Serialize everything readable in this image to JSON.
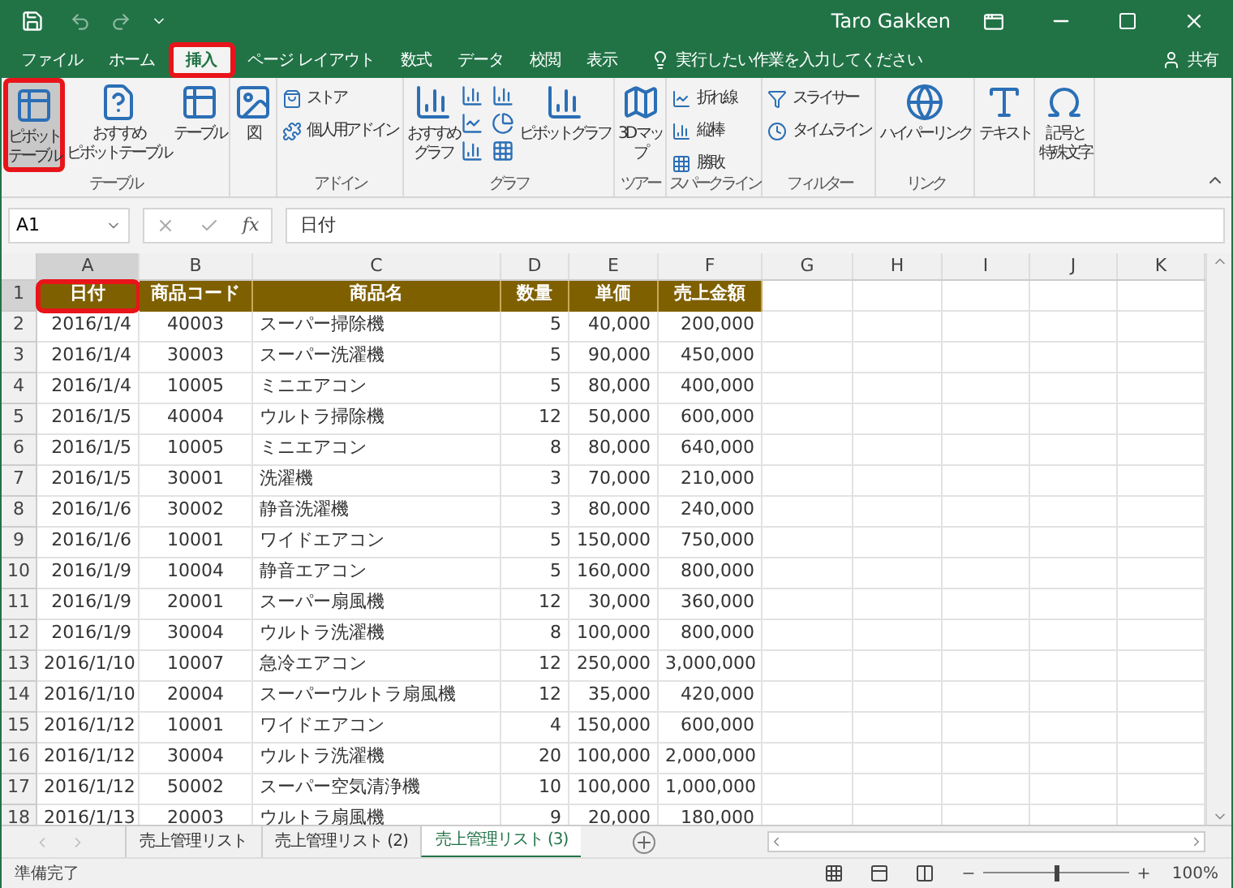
{
  "title_bar": {
    "user": "Taro Gakken"
  },
  "ribbon_tabs": [
    {
      "label": "ファイル",
      "selected": false,
      "highlighted": false
    },
    {
      "label": "ホーム",
      "selected": false,
      "highlighted": false
    },
    {
      "label": "挿入",
      "selected": true,
      "highlighted": true
    },
    {
      "label": "ページ レイアウト",
      "selected": false,
      "highlighted": false
    },
    {
      "label": "数式",
      "selected": false,
      "highlighted": false
    },
    {
      "label": "データ",
      "selected": false,
      "highlighted": false
    },
    {
      "label": "校閲",
      "selected": false,
      "highlighted": false
    },
    {
      "label": "表示",
      "selected": false,
      "highlighted": false
    }
  ],
  "tell_me": {
    "placeholder": "実行したい作業を入力してください"
  },
  "share": "共有",
  "ribbon_groups": [
    {
      "label": "テーブル",
      "items": [
        {
          "kind": "large",
          "lines": [
            "ピボット",
            "テーブル"
          ],
          "highlighted": true
        },
        {
          "kind": "large",
          "lines": [
            "おすすめ",
            "ピボットテーブル"
          ],
          "highlighted": false
        },
        {
          "kind": "large",
          "lines": [
            "テーブル"
          ],
          "highlighted": false
        }
      ]
    },
    {
      "items": [
        {
          "kind": "large",
          "lines": [
            "図"
          ],
          "highlighted": false
        }
      ]
    },
    {
      "label": "アドイン",
      "items": [
        {
          "kind": "small",
          "label": "ストア",
          "highlighted": false
        },
        {
          "kind": "small",
          "label": "個人用アドイン",
          "highlighted": false
        }
      ]
    },
    {
      "label": "グラフ",
      "items": [
        {
          "kind": "large",
          "lines": [
            "おすすめ",
            "グラフ"
          ],
          "highlighted": false
        },
        {
          "kind": "charts"
        },
        {
          "kind": "large",
          "lines": [
            "ピボットグラフ"
          ],
          "highlighted": false
        }
      ]
    },
    {
      "label": "ツアー",
      "items": [
        {
          "kind": "large",
          "lines": [
            "3D マッ",
            "プ"
          ],
          "highlighted": false
        }
      ]
    },
    {
      "label": "スパークライン",
      "items": [
        {
          "kind": "small",
          "label": "折れ線",
          "highlighted": false
        },
        {
          "kind": "small",
          "label": "縦棒",
          "highlighted": false
        },
        {
          "kind": "small",
          "label": "勝敗",
          "highlighted": false
        }
      ]
    },
    {
      "label": "フィルター",
      "items": [
        {
          "kind": "small",
          "label": "スライサー",
          "highlighted": false
        },
        {
          "kind": "small",
          "label": "タイムライン",
          "highlighted": false
        }
      ]
    },
    {
      "label": "リンク",
      "items": [
        {
          "kind": "large",
          "lines": [
            "ハイパーリンク"
          ],
          "highlighted": false
        }
      ]
    },
    {
      "items": [
        {
          "kind": "large",
          "lines": [
            "テキスト"
          ],
          "highlighted": false
        }
      ]
    },
    {
      "items": [
        {
          "kind": "large",
          "lines": [
            "記号と",
            "特殊文字"
          ],
          "highlighted": false
        }
      ]
    }
  ],
  "formula_bar": {
    "name_box": "A1",
    "fx": "fx",
    "value": "日付"
  },
  "columns": [
    "A",
    "B",
    "C",
    "D",
    "E",
    "F",
    "G",
    "H",
    "I",
    "J",
    "K"
  ],
  "header_row": {
    "number": "1",
    "cells": [
      {
        "text": "日付",
        "highlighted": true
      },
      {
        "text": "商品コード",
        "highlighted": false
      },
      {
        "text": "商品名",
        "highlighted": false
      },
      {
        "text": "数量",
        "highlighted": false
      },
      {
        "text": "単価",
        "highlighted": false
      },
      {
        "text": "売上金額",
        "highlighted": false
      }
    ]
  },
  "rows": [
    [
      "2",
      "2016/1/4",
      "40003",
      "スーパー掃除機",
      "5",
      "40,000",
      "200,000"
    ],
    [
      "3",
      "2016/1/4",
      "30003",
      "スーパー洗濯機",
      "5",
      "90,000",
      "450,000"
    ],
    [
      "4",
      "2016/1/4",
      "10005",
      "ミニエアコン",
      "5",
      "80,000",
      "400,000"
    ],
    [
      "5",
      "2016/1/5",
      "40004",
      "ウルトラ掃除機",
      "12",
      "50,000",
      "600,000"
    ],
    [
      "6",
      "2016/1/5",
      "10005",
      "ミニエアコン",
      "8",
      "80,000",
      "640,000"
    ],
    [
      "7",
      "2016/1/5",
      "30001",
      "洗濯機",
      "3",
      "70,000",
      "210,000"
    ],
    [
      "8",
      "2016/1/6",
      "30002",
      "静音洗濯機",
      "3",
      "80,000",
      "240,000"
    ],
    [
      "9",
      "2016/1/6",
      "10001",
      "ワイドエアコン",
      "5",
      "150,000",
      "750,000"
    ],
    [
      "10",
      "2016/1/9",
      "10004",
      "静音エアコン",
      "5",
      "160,000",
      "800,000"
    ],
    [
      "11",
      "2016/1/9",
      "20001",
      "スーパー扇風機",
      "12",
      "30,000",
      "360,000"
    ],
    [
      "12",
      "2016/1/9",
      "30004",
      "ウルトラ洗濯機",
      "8",
      "100,000",
      "800,000"
    ],
    [
      "13",
      "2016/1/10",
      "10007",
      "急冷エアコン",
      "12",
      "250,000",
      "3,000,000"
    ],
    [
      "14",
      "2016/1/10",
      "20004",
      "スーパーウルトラ扇風機",
      "12",
      "35,000",
      "420,000"
    ],
    [
      "15",
      "2016/1/12",
      "10001",
      "ワイドエアコン",
      "4",
      "150,000",
      "600,000"
    ],
    [
      "16",
      "2016/1/12",
      "30004",
      "ウルトラ洗濯機",
      "20",
      "100,000",
      "2,000,000"
    ],
    [
      "17",
      "2016/1/12",
      "50002",
      "スーパー空気清浄機",
      "10",
      "100,000",
      "1,000,000"
    ],
    [
      "18",
      "2016/1/13",
      "20003",
      "ウルトラ扇風機",
      "9",
      "20,000",
      "180,000"
    ]
  ],
  "sheet_tabs": [
    {
      "label": "売上管理リスト",
      "selected": false
    },
    {
      "label": "売上管理リスト (2)",
      "selected": false
    },
    {
      "label": "売上管理リスト (3)",
      "selected": true
    }
  ],
  "status_bar": {
    "status": "準備完了",
    "zoom": "100%",
    "zoom_slider": {
      "level": 0.5
    }
  }
}
